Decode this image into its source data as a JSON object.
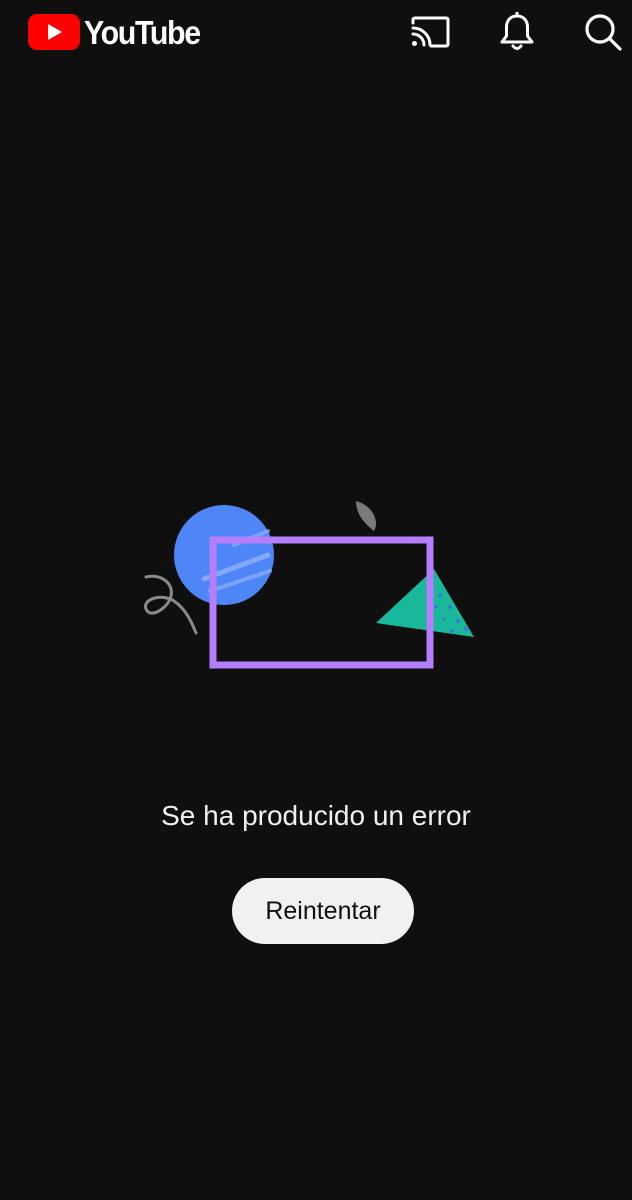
{
  "header": {
    "logo_text": "YouTube",
    "logo_color": "#ff0000",
    "cast_icon": "cast-icon",
    "notifications_icon": "bell-icon",
    "search_icon": "search-icon"
  },
  "error": {
    "message": "Se ha producido un error",
    "retry_label": "Reintentar"
  },
  "colors": {
    "background": "#0f0f0f",
    "text": "#f1f1f1",
    "button_background": "#f1f1f1",
    "button_text": "#0f0f0f",
    "illustration_frame": "#b47eff",
    "illustration_circle": "#4f86f7",
    "illustration_triangle": "#19b89a"
  }
}
